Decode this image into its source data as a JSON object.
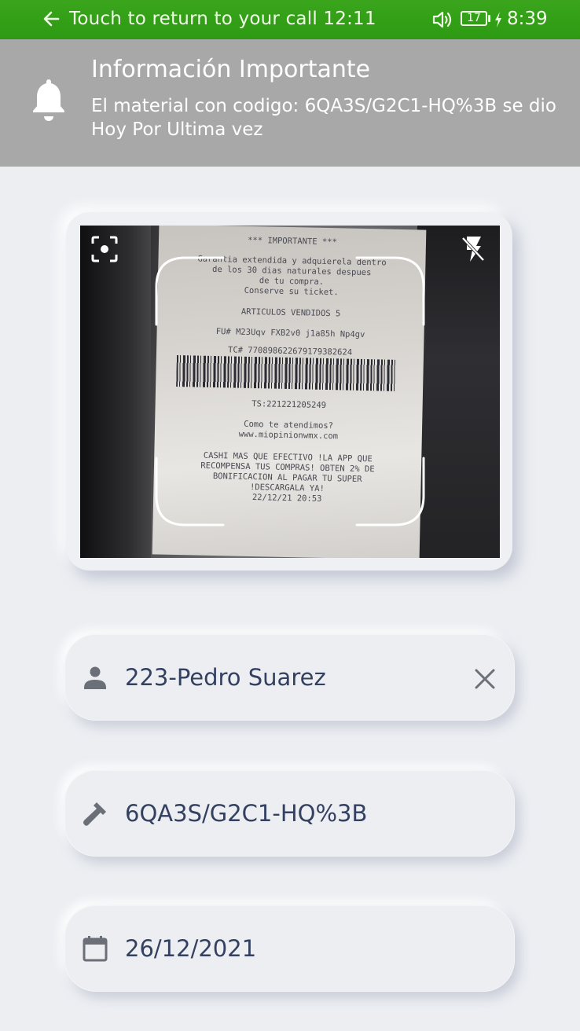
{
  "status_bar": {
    "call_banner": "Touch to return to your call 12:11",
    "battery": "17",
    "clock": "8:39",
    "icons": [
      "back-arrow-icon",
      "speaker-icon",
      "battery-icon",
      "charging-bolt-icon"
    ]
  },
  "notification": {
    "icon": "bell-icon",
    "title": "Información Importante",
    "body": "El material con codigo: 6QA3S/G2C1-HQ%3B se dio Hoy Por Ultima vez"
  },
  "camera": {
    "icons": [
      "focus-icon",
      "flash-off-icon"
    ],
    "receipt": {
      "line1": "*** IMPORTANTE ***",
      "line2": "Garantia extendida y adquierela dentro",
      "line3": "de los 30 dias naturales despues",
      "line4": "de tu compra.",
      "line5": "Conserve su ticket.",
      "articles": "ARTICULOS VENDIDOS      5",
      "fu": "FU# M23Uqv FXB2v0 j1a85h Np4gv",
      "tc": "TC#  770898622679179382624",
      "ts": "TS:221221205249",
      "como": "Como te atendimos?",
      "web": "www.miopinionwmx.com",
      "promo1": "CASHI MAS QUE EFECTIVO !LA APP QUE",
      "promo2": "RECOMPENSA TUS COMPRAS! OBTEN 2% DE",
      "promo3": "BONIFICACION AL PAGAR TU SUPER",
      "promo4": "!DESCARGALA YA!",
      "datetime": "22/12/21      20:53"
    }
  },
  "fields": {
    "person": {
      "icon": "person-icon",
      "value": "223-Pedro Suarez",
      "clear_icon": "close-icon"
    },
    "material": {
      "icon": "hammer-icon",
      "value": "6QA3S/G2C1-HQ%3B"
    },
    "date": {
      "icon": "calendar-icon",
      "value": "26/12/2021"
    }
  },
  "colors": {
    "status_bar": "#2c9a12",
    "notification_bg": "#a8a8a8",
    "page_bg": "#eceef2",
    "field_text": "#334060",
    "field_icon": "#6b6f78"
  }
}
